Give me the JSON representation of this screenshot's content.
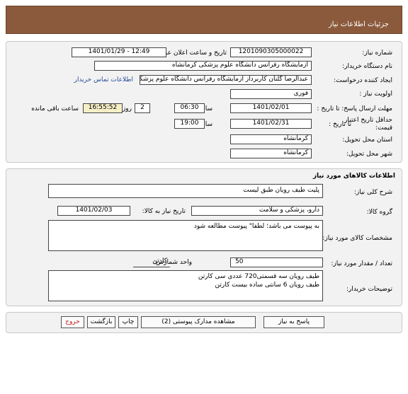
{
  "header": {
    "title": "جزئیات اطلاعات نیاز"
  },
  "info": {
    "need_number_label": "شماره نیاز:",
    "need_number": "1201090305000022",
    "announce_label": "تاریخ و ساعت اعلان عمومی:",
    "announce_value": "1401/01/29 - 12:49",
    "buyer_label": "نام دستگاه خریدار:",
    "buyer_value": "آزمایشگاه رفرانس دانشگاه علوم پزشکی کرمانشاه",
    "creator_label": "ایجاد کننده درخواست:",
    "creator_value": "عبدالرضا گلنان کاربرداز آزمایشگاه رفرانس دانشگاه علوم پزشکی کرمانشاه",
    "contact_link": "اطلاعات تماس خریدار",
    "priority_label": "اولویت نیاز :",
    "priority_value": "فوری",
    "deadline_label": "مهلت ارسال پاسخ: تا تاریخ :",
    "deadline_date": "1401/02/01",
    "deadline_time_label": "ساعت",
    "deadline_time": "06:30",
    "days_value": "2",
    "days_label": "روز و",
    "remaining_time": "16:55:52",
    "remaining_label": "ساعت باقی مانده",
    "validity_label_1": "حداقل تاریخ اعتبار",
    "validity_label_2": "قیمت:",
    "validity_prefix": "تا تاریخ :",
    "validity_date": "1401/02/31",
    "validity_time_label": "ساعت",
    "validity_time": "19:00",
    "province_label": "استان محل تحویل:",
    "province_value": "کرمانشاه",
    "city_label": "شهر محل تحویل:",
    "city_value": "کرمانشاه"
  },
  "goods": {
    "section_title": "اطلاعات کالاهای مورد نیاز",
    "summary_label": "شرح کلی نیاز:",
    "summary_value": "پلیت طیف رویان طبق لیست",
    "group_label": "گروه کالا:",
    "group_value": "دارو، پزشکی و سلامت",
    "need_date_label": "تاریخ نیاز به کالا:",
    "need_date_value": "1401/02/03",
    "specs_label": "مشخصات کالای مورد نیاز:",
    "specs_value": "به پیوست می باشد؛ لطفا\" پیوست مطالعه شود",
    "qty_label": "تعداد / مقدار مورد نیاز:",
    "qty_value": "50",
    "unit_label": "واحد شمارش:",
    "unit_value": "کارتن",
    "notes_label": "توضیحات خریدار:",
    "notes_value": "طیف رویان سه قسمتی720 عددی سی کارتن\nطیف رویان 6 سانتی ساده بیست کارتن"
  },
  "actions": {
    "reply": "پاسخ به نیاز",
    "attachments": "مشاهده مدارک پیوستی (2)",
    "print": "چاپ",
    "back": "بازگشت",
    "exit": "خروج"
  },
  "colors": {
    "title_bar": "#8b5a3c",
    "panel": "#f2f2f2",
    "highlight": "#f6efc6",
    "exit_text": "#c01e1e"
  }
}
